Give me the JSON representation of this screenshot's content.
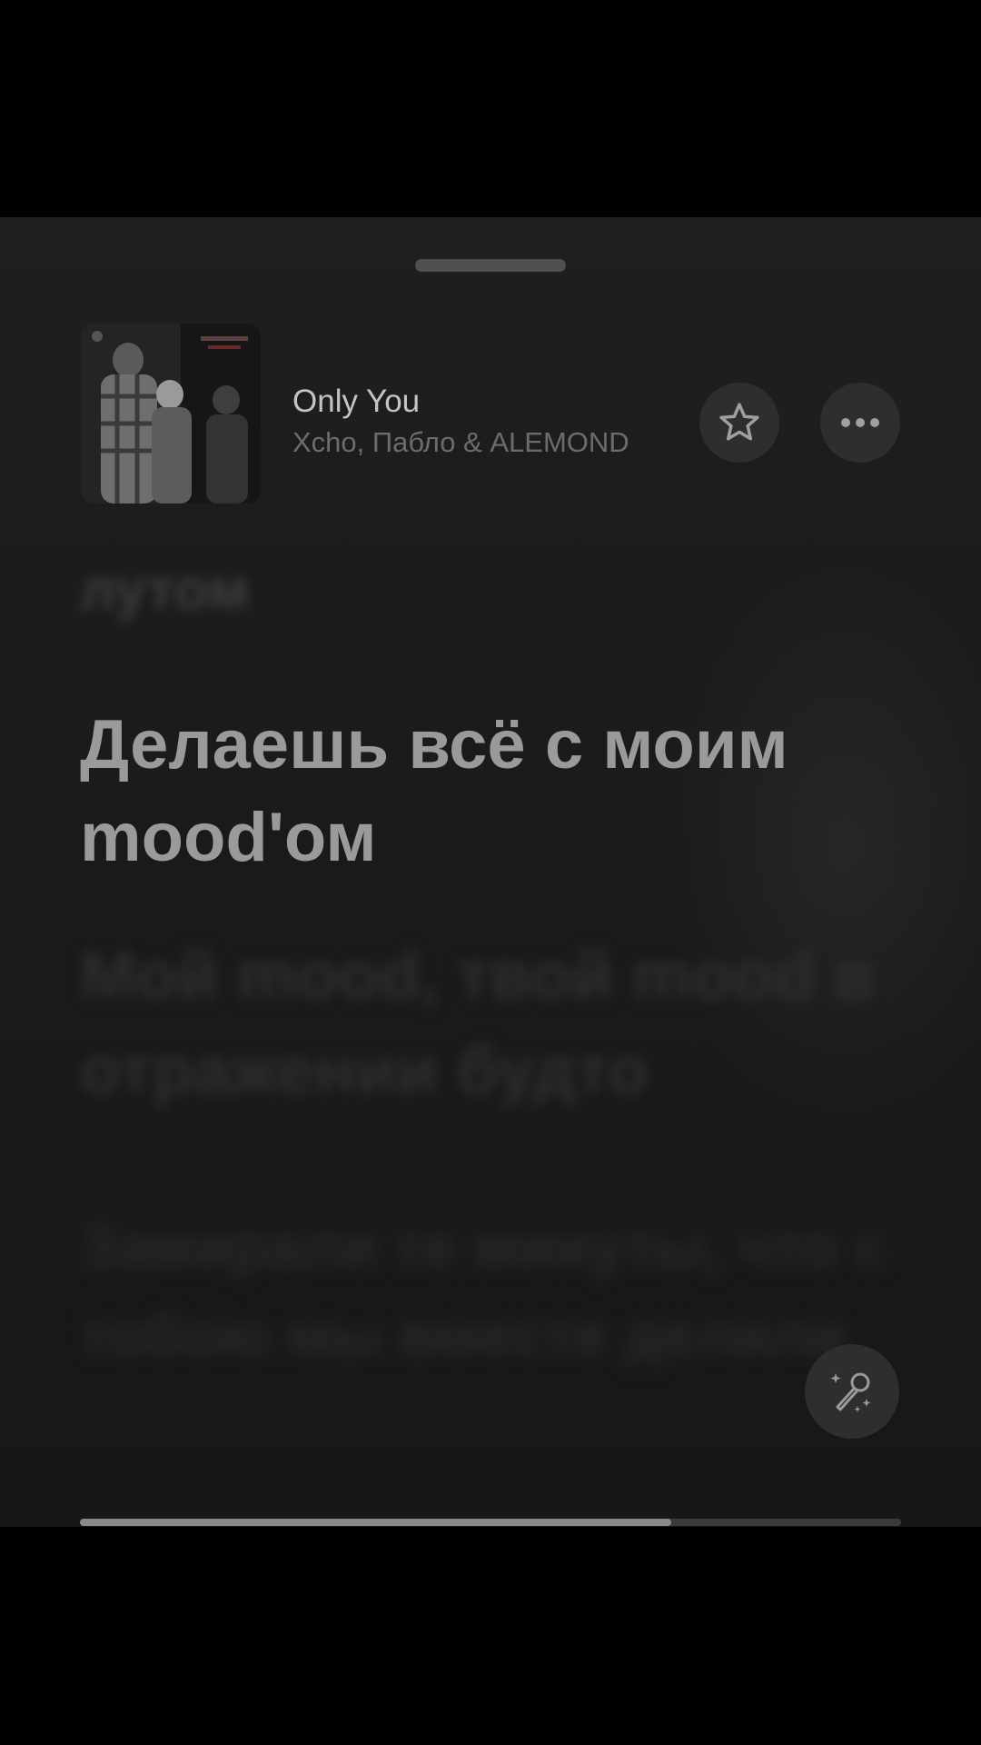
{
  "now_playing": {
    "title": "Only You",
    "artist": "Xcho, Пабло & ALEMOND",
    "progress": 0.72
  },
  "lyrics": {
    "previous": "лутом",
    "current": "Делаешь всё с моим mood'ом",
    "next": "Мой mood, твой mood в отражении будто",
    "after_next": "Замирали те минуты, что с тобою мы вместе делили"
  },
  "icons": {
    "favorite": "star-icon",
    "more": "ellipsis-icon",
    "lyrics_mode": "microphone-sparkle-icon"
  },
  "colors": {
    "background": "#1c1c1c",
    "button": "#2e2e2e",
    "current_lyric": "#9a9a9a"
  }
}
